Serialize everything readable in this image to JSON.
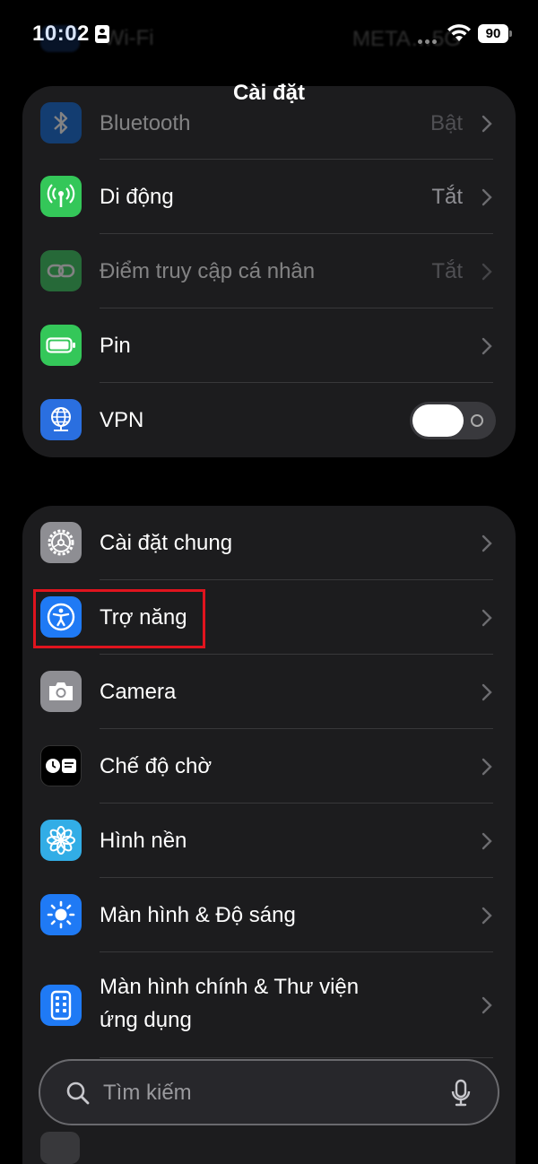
{
  "status": {
    "time": "10:02",
    "battery": "90"
  },
  "header": {
    "title": "Cài đặt"
  },
  "ghost": {
    "label": "Wi-Fi",
    "value": "META…5G"
  },
  "group1": [
    {
      "id": "bluetooth",
      "label": "Bluetooth",
      "value": "Bật",
      "icon": "bluetooth-icon",
      "color": "#0a66d8",
      "dim": true
    },
    {
      "id": "cellular",
      "label": "Di động",
      "value": "Tắt",
      "icon": "antenna-icon",
      "color": "#34c759"
    },
    {
      "id": "hotspot",
      "label": "Điểm truy cập cá nhân",
      "value": "Tắt",
      "icon": "link-icon",
      "color": "#34c759",
      "dim": true
    },
    {
      "id": "battery",
      "label": "Pin",
      "value": "",
      "icon": "battery-icon",
      "color": "#34c759"
    },
    {
      "id": "vpn",
      "label": "VPN",
      "value": "",
      "icon": "globe-network-icon",
      "color": "#2a6fe0"
    }
  ],
  "group2": [
    {
      "id": "general",
      "label": "Cài đặt chung",
      "icon": "gear-icon",
      "color": "#8e8e93"
    },
    {
      "id": "accessibility",
      "label": "Trợ năng",
      "icon": "accessibility-icon",
      "color": "#1f7af5"
    },
    {
      "id": "camera",
      "label": "Camera",
      "icon": "camera-icon",
      "color": "#8e8e93"
    },
    {
      "id": "standby",
      "label": "Chế độ chờ",
      "icon": "standby-icon",
      "color": "#000000"
    },
    {
      "id": "wallpaper",
      "label": "Hình nền",
      "icon": "flower-icon",
      "color": "#32ade6"
    },
    {
      "id": "display",
      "label": "Màn hình & Độ sáng",
      "icon": "sun-icon",
      "color": "#1f7af5"
    },
    {
      "id": "homescreen",
      "label": "Màn hình chính & Thư viện ứng dụng",
      "icon": "phone-grid-icon",
      "color": "#1f7af5"
    }
  ],
  "search": {
    "placeholder": "Tìm kiếm"
  },
  "vpn_toggle": {
    "on": false
  }
}
